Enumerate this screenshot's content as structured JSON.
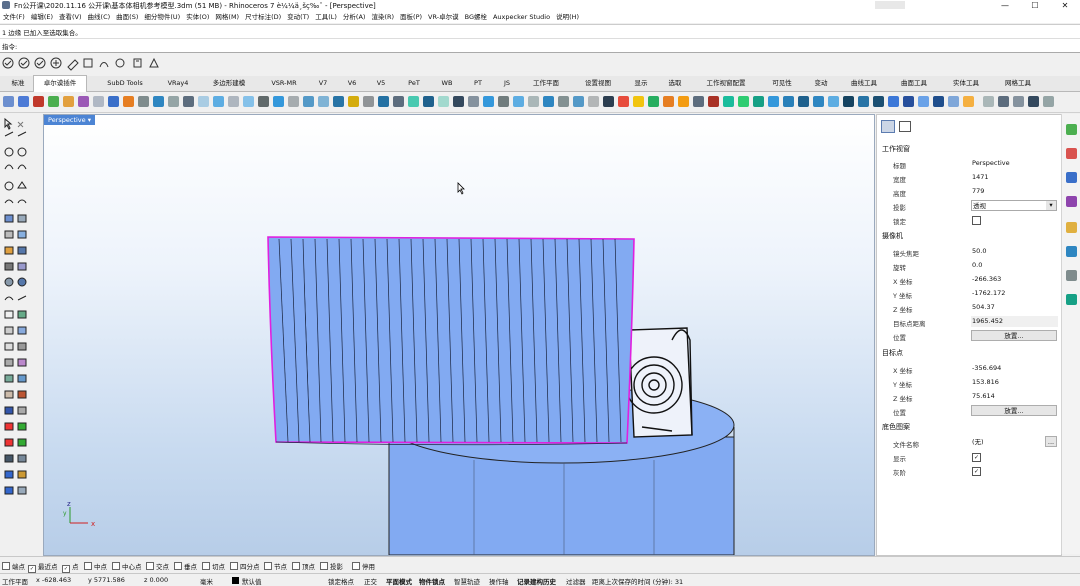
{
  "window": {
    "title": "Fn公开课\\2020.11.16 公开课\\基本体相机参考模型.3dm (51 MB) - Rhinoceros 7 è¼¼ä¸šç‰ˆ - [Perspective]",
    "controls": [
      "—",
      "☐",
      "✕"
    ]
  },
  "menu": [
    "文件(F)",
    "编辑(E)",
    "查看(V)",
    "曲线(C)",
    "曲面(S)",
    "细分物件(U)",
    "实体(O)",
    "网格(M)",
    "尺寸标注(D)",
    "变动(T)",
    "工具(L)",
    "分析(A)",
    "渲染(R)",
    "面板(P)",
    "VR-卓尔谟",
    "BG螺栓",
    "Auxpecker Studio",
    "说明(H)"
  ],
  "command": {
    "history": "1 边缘 已加入至选取集合。",
    "prompt": "指令:"
  },
  "tabs": [
    "标准",
    "卓尔谟插件",
    "SubD Tools",
    "VRay4",
    "多边形建模",
    "VSR-MR",
    "V7",
    "V6",
    "V5",
    "PeT",
    "WB",
    "PT",
    "JS",
    "工作平面",
    "设置视图",
    "显示",
    "选取",
    "工作视窗配置",
    "可见性",
    "变动",
    "曲线工具",
    "曲面工具",
    "实体工具",
    "网格工具"
  ],
  "active_tab": "卓尔谟插件",
  "viewport": {
    "name": "Perspective",
    "axes": {
      "x": "x",
      "y": "y",
      "z": "z"
    }
  },
  "properties": {
    "section_viewport": "工作视窗",
    "viewport_rows": [
      {
        "label": "标题",
        "value": "Perspective"
      },
      {
        "label": "宽度",
        "value": "1471"
      },
      {
        "label": "高度",
        "value": "779"
      },
      {
        "label": "投影",
        "value": "透视"
      },
      {
        "label": "锁定",
        "value": ""
      }
    ],
    "section_camera": "摄像机",
    "camera_rows": [
      {
        "label": "镜头焦距",
        "value": "50.0"
      },
      {
        "label": "旋转",
        "value": "0.0"
      },
      {
        "label": "X 坐标",
        "value": "-266.363"
      },
      {
        "label": "Y 坐标",
        "value": "-1762.172"
      },
      {
        "label": "Z 坐标",
        "value": "504.37"
      },
      {
        "label": "目标点距离",
        "value": "1965.452"
      },
      {
        "label": "位置",
        "value": "放置..."
      }
    ],
    "section_target": "目标点",
    "target_rows": [
      {
        "label": "X 坐标",
        "value": "-356.694"
      },
      {
        "label": "Y 坐标",
        "value": "153.816"
      },
      {
        "label": "Z 坐标",
        "value": "75.614"
      },
      {
        "label": "位置",
        "value": "放置..."
      }
    ],
    "section_wallpaper": "底色图案",
    "wallpaper_rows": [
      {
        "label": "文件名称",
        "value": "(无)"
      },
      {
        "label": "显示",
        "value": "✓"
      },
      {
        "label": "灰阶",
        "value": "✓"
      }
    ],
    "more_button": "..."
  },
  "osnaps": [
    {
      "label": "端点",
      "checked": false
    },
    {
      "label": "最近点",
      "checked": true
    },
    {
      "label": "点",
      "checked": true
    },
    {
      "label": "中点",
      "checked": false
    },
    {
      "label": "中心点",
      "checked": false
    },
    {
      "label": "交点",
      "checked": false
    },
    {
      "label": "垂点",
      "checked": false
    },
    {
      "label": "切点",
      "checked": false
    },
    {
      "label": "四分点",
      "checked": false
    },
    {
      "label": "节点",
      "checked": false
    },
    {
      "label": "顶点",
      "checked": false
    },
    {
      "label": "投影",
      "checked": false
    },
    {
      "label": "停用",
      "checked": false
    }
  ],
  "status": {
    "cplane": "工作平面",
    "x": "x -628.463",
    "y": "y 5771.586",
    "z": "z 0.000",
    "unit": "毫米",
    "layer": "默认值",
    "items": [
      "锁定格点",
      "正交",
      "平面模式",
      "物件锁点",
      "智慧轨迹",
      "操作轴",
      "记录建构历史",
      "过滤器"
    ],
    "autosave": "距离上次保存的时间 (分钟): 31"
  },
  "colors": {
    "viewport_tab": "#4c84d4",
    "surface": "#82aaf2",
    "selection": "#e020e0"
  }
}
